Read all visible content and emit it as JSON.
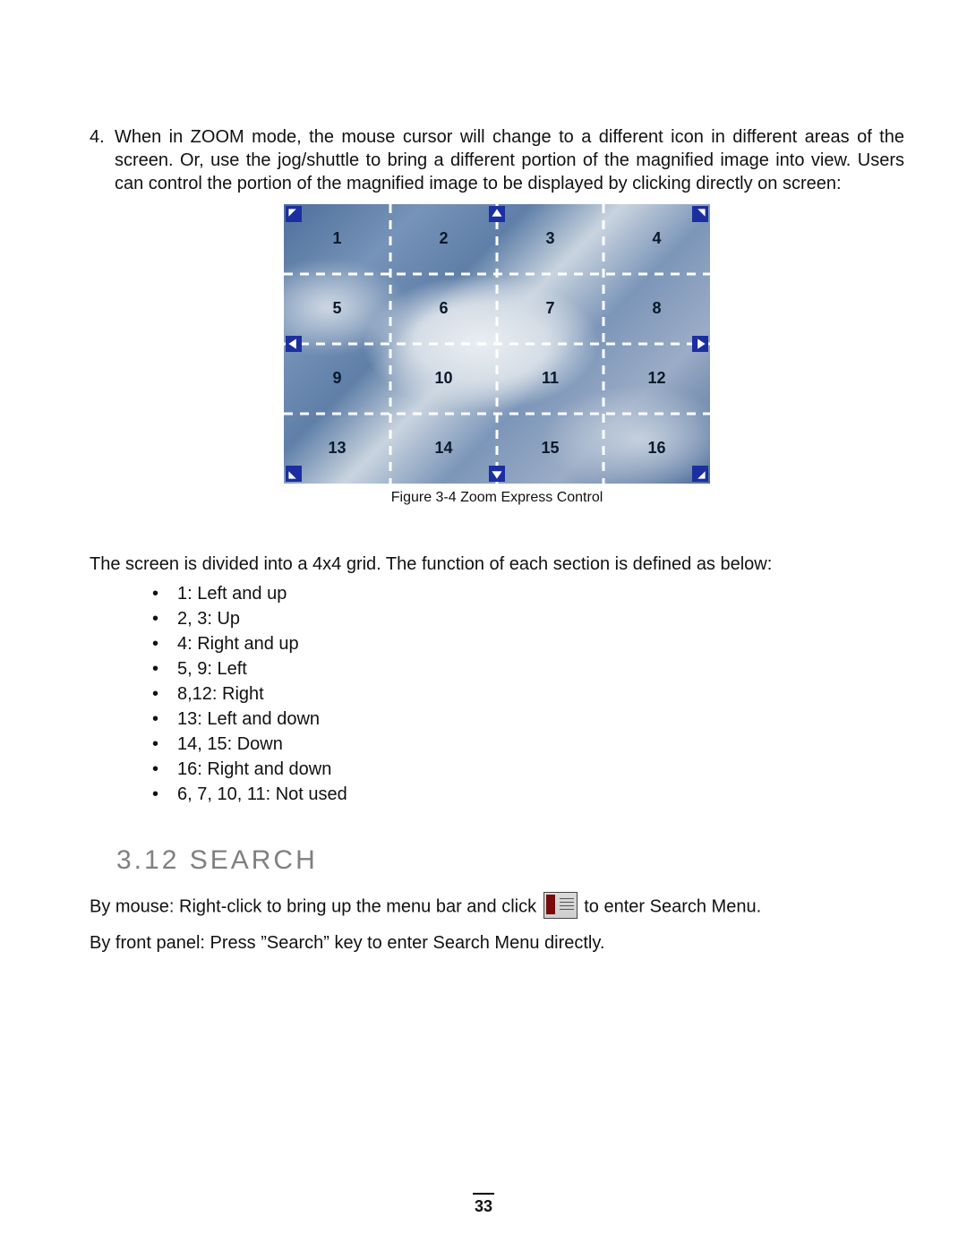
{
  "orderedItem": {
    "number": "4.",
    "text": "When in ZOOM mode, the mouse cursor will change to a different icon in different areas of the screen. Or, use the jog/shuttle to bring a different portion of the magnified image into view. Users can control the portion of the magnified image to be displayed by clicking directly on screen:"
  },
  "figure": {
    "cells": [
      "1",
      "2",
      "3",
      "4",
      "5",
      "6",
      "7",
      "8",
      "9",
      "10",
      "11",
      "12",
      "13",
      "14",
      "15",
      "16"
    ],
    "caption": "Figure 3-4 Zoom Express Control"
  },
  "gridIntro": "The screen is divided into a 4x4 grid. The function of each section is defined as below:",
  "gridList": [
    "1: Left and up",
    "2, 3: Up",
    "4: Right and up",
    "5, 9: Left",
    "8,12: Right",
    "13: Left and down",
    "14, 15: Down",
    "16: Right and down",
    "6, 7, 10, 11: Not used"
  ],
  "section": {
    "heading": "3.12 SEARCH"
  },
  "searchMouse": {
    "pre": "By mouse: Right-click to bring up the menu bar and click ",
    "post": " to enter Search Menu."
  },
  "searchPanel": "By front panel: Press ”Search” key to enter Search Menu directly.",
  "pageNumber": "33"
}
